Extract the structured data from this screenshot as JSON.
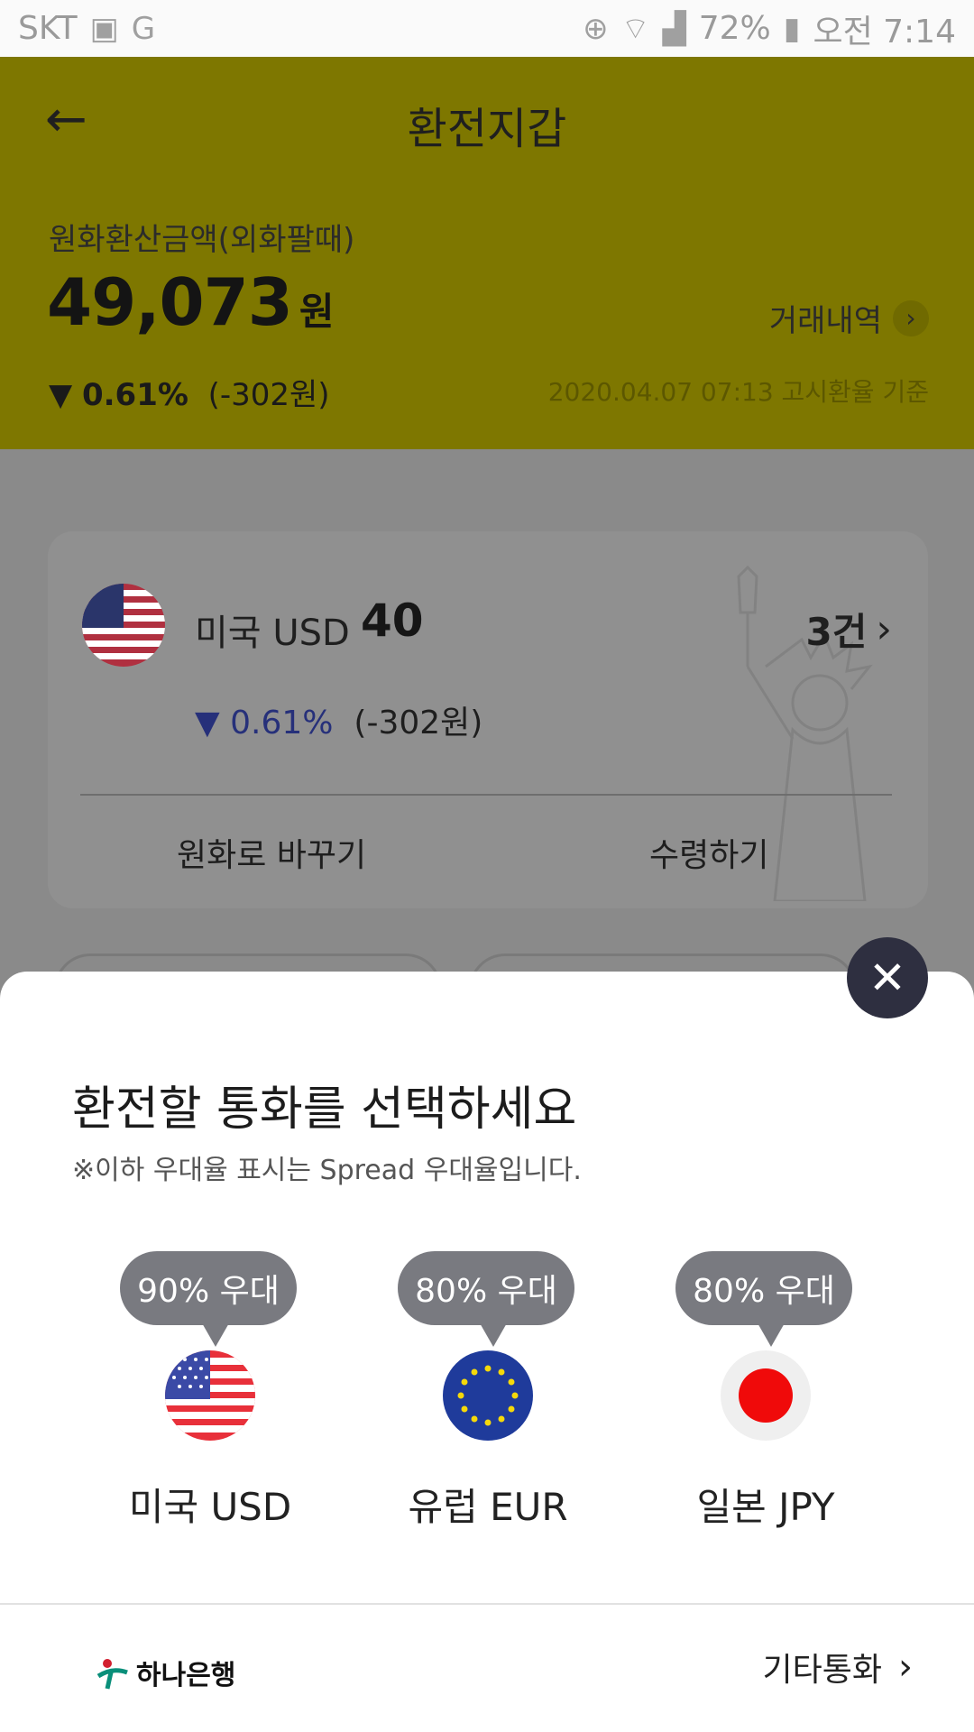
{
  "status_bar": {
    "carrier": "SKT",
    "battery": "72%",
    "time": "오전 7:14"
  },
  "header": {
    "title": "환전지갑",
    "krw_label": "원화환산금액(외화팔때)",
    "amount": "49,073",
    "amount_unit": "원",
    "change_arrow": "▼",
    "change_pct": "0.61%",
    "change_amt": "(-302원)",
    "history_label": "거래내역",
    "rate_basis": "2020.04.07 07:13 고시환율 기준"
  },
  "card": {
    "currency": "미국 USD",
    "amount": "40",
    "count": "3건",
    "change_arrow": "▼",
    "change_pct": "0.61%",
    "change_amt": "(-302원)",
    "btn_convert": "원화로 바꾸기",
    "btn_receive": "수령하기"
  },
  "sheet": {
    "title": "환전할 통화를 선택하세요",
    "note": "※이하 우대율 표시는 Spread 우대율입니다.",
    "currencies": [
      {
        "badge": "90% 우대",
        "name": "미국 USD",
        "icon": "us-flag-icon"
      },
      {
        "badge": "80% 우대",
        "name": "유럽 EUR",
        "icon": "eu-flag-icon"
      },
      {
        "badge": "80% 우대",
        "name": "일본 JPY",
        "icon": "jp-flag-icon"
      }
    ],
    "bank": "하나은행",
    "other_label": "기타통화"
  },
  "colors": {
    "header_bg": "#7e7700",
    "sheet_bg": "#ffffff",
    "badge_bg": "#797a80",
    "close_bg": "#2e2f40"
  }
}
